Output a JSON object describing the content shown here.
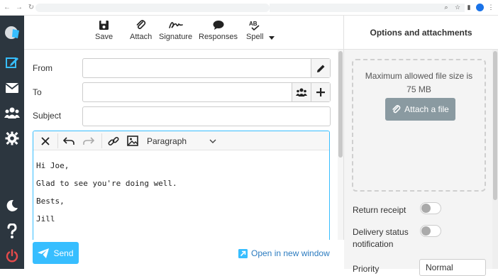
{
  "toolbar": {
    "save": "Save",
    "attach": "Attach",
    "signature": "Signature",
    "responses": "Responses",
    "spell": "Spell"
  },
  "form": {
    "from_label": "From",
    "to_label": "To",
    "subject_label": "Subject",
    "from_value": "",
    "to_value": "",
    "subject_value": ""
  },
  "editor": {
    "format": "Paragraph",
    "lines": [
      "Hi Joe,",
      "Glad to see you're doing well.",
      "Bests,",
      "Jill"
    ]
  },
  "footer": {
    "send": "Send",
    "open_new_window": "Open in new window"
  },
  "sidebar": {
    "title": "Options and attachments",
    "max_size_line1": "Maximum allowed file size is",
    "max_size_line2": "75 MB",
    "attach_file": "Attach a file",
    "return_receipt": "Return receipt",
    "delivery_line1": "Delivery status",
    "delivery_line2": "notification",
    "priority_label": "Priority",
    "priority_value": "Normal"
  },
  "colors": {
    "rail": "#2c363f",
    "accent": "#37beff",
    "compose_icon": "#37beff",
    "logout": "#e54b4b",
    "attach_button": "#8a9aa1"
  },
  "icons": {
    "save": "floppy-disk-icon",
    "attach": "paperclip-icon",
    "signature": "signature-icon",
    "responses": "speech-bubble-icon",
    "spell": "spellcheck-icon"
  }
}
